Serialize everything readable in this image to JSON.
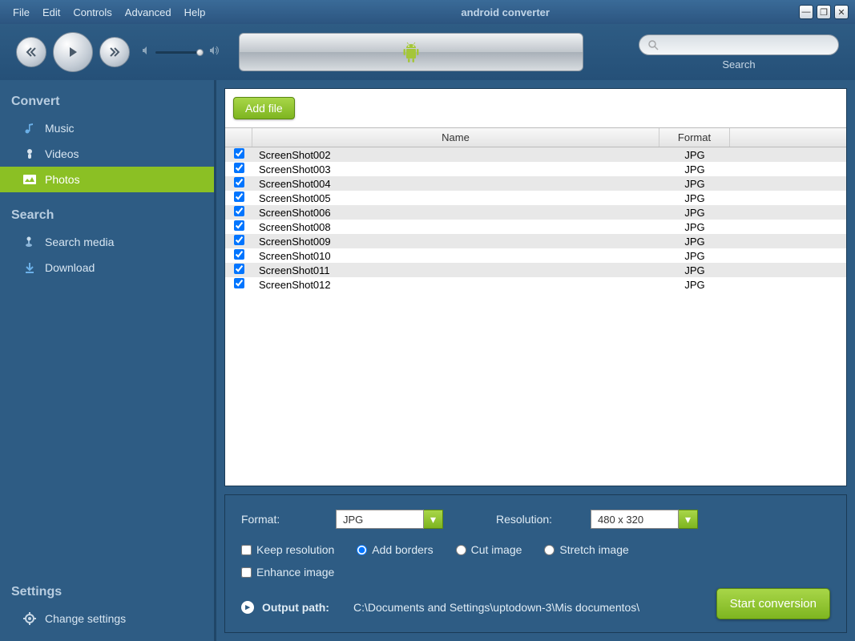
{
  "menubar": {
    "items": [
      "File",
      "Edit",
      "Controls",
      "Advanced",
      "Help"
    ],
    "title": "android converter"
  },
  "toolbar": {
    "search_label": "Search",
    "search_placeholder": ""
  },
  "sidebar": {
    "convert_title": "Convert",
    "convert_items": [
      {
        "label": "Music",
        "icon": "music-icon"
      },
      {
        "label": "Videos",
        "icon": "video-icon"
      },
      {
        "label": "Photos",
        "icon": "photo-icon",
        "active": true
      }
    ],
    "search_title": "Search",
    "search_items": [
      {
        "label": "Search media",
        "icon": "search-media-icon"
      },
      {
        "label": "Download",
        "icon": "download-icon"
      }
    ],
    "settings_title": "Settings",
    "settings_items": [
      {
        "label": "Change settings",
        "icon": "gear-icon"
      }
    ]
  },
  "main": {
    "add_file_label": "Add file",
    "columns": {
      "name": "Name",
      "format": "Format"
    },
    "rows": [
      {
        "checked": true,
        "name": "ScreenShot002",
        "format": "JPG"
      },
      {
        "checked": true,
        "name": "ScreenShot003",
        "format": "JPG"
      },
      {
        "checked": true,
        "name": "ScreenShot004",
        "format": "JPG"
      },
      {
        "checked": true,
        "name": "ScreenShot005",
        "format": "JPG"
      },
      {
        "checked": true,
        "name": "ScreenShot006",
        "format": "JPG"
      },
      {
        "checked": true,
        "name": "ScreenShot008",
        "format": "JPG"
      },
      {
        "checked": true,
        "name": "ScreenShot009",
        "format": "JPG"
      },
      {
        "checked": true,
        "name": "ScreenShot010",
        "format": "JPG"
      },
      {
        "checked": true,
        "name": "ScreenShot011",
        "format": "JPG"
      },
      {
        "checked": true,
        "name": "ScreenShot012",
        "format": "JPG"
      }
    ]
  },
  "options": {
    "format_label": "Format:",
    "format_value": "JPG",
    "resolution_label": "Resolution:",
    "resolution_value": "480 x 320",
    "keep_resolution": "Keep resolution",
    "add_borders": "Add borders",
    "cut_image": "Cut image",
    "stretch_image": "Stretch image",
    "enhance_image": "Enhance image",
    "output_path_label": "Output path:",
    "output_path_value": "C:\\Documents and Settings\\uptodown-3\\Mis documentos\\",
    "start_button": "Start conversion",
    "selected_radio": "add_borders"
  }
}
